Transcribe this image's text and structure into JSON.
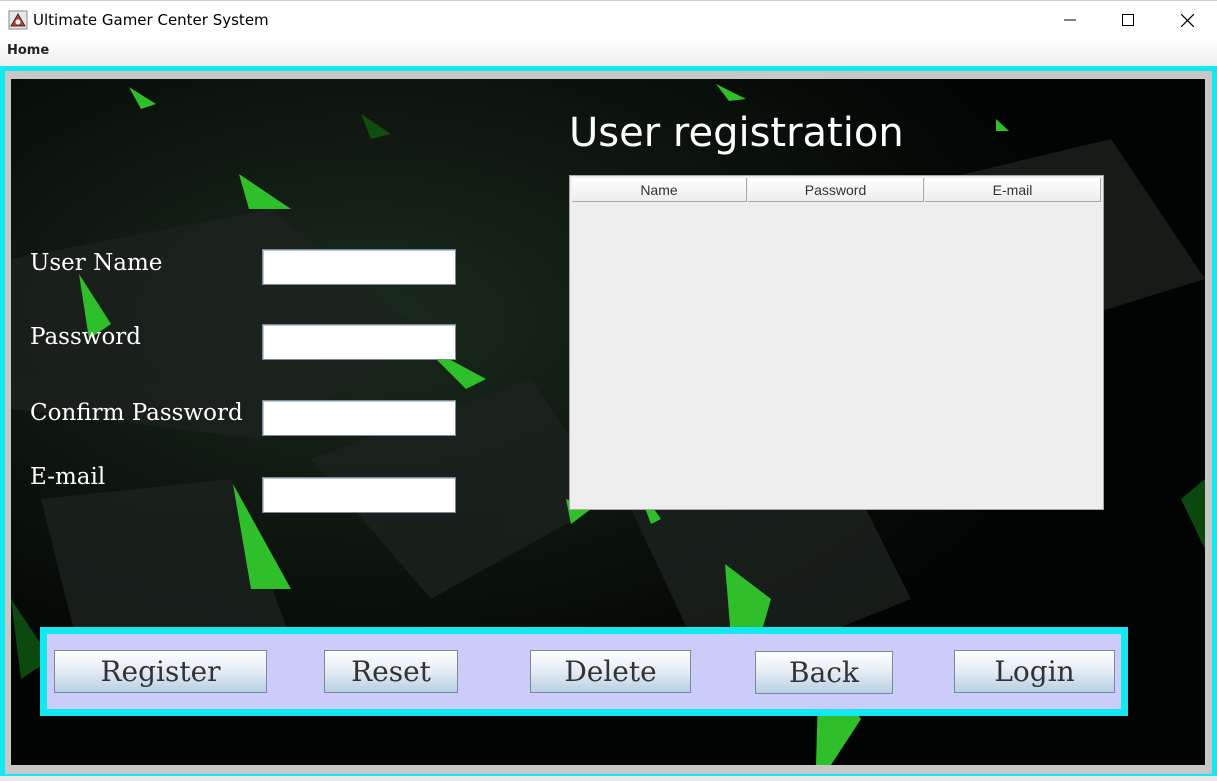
{
  "window": {
    "title": "Ultimate Gamer Center System",
    "controls": [
      "minimize-icon",
      "maximize-icon",
      "close-icon"
    ]
  },
  "menu": {
    "items": [
      {
        "label": "Home"
      }
    ]
  },
  "page": {
    "heading": "User registration"
  },
  "form": {
    "username": {
      "label": "User Name",
      "value": "",
      "placeholder": ""
    },
    "password": {
      "label": "Password",
      "value": "",
      "placeholder": ""
    },
    "confirm_password": {
      "label": "Confirm Password",
      "value": "",
      "placeholder": ""
    },
    "email": {
      "label": "E-mail",
      "value": "",
      "placeholder": ""
    }
  },
  "table": {
    "columns": [
      "Name",
      "Password",
      "E-mail"
    ],
    "rows": []
  },
  "buttons": {
    "register": "Register",
    "reset": "Reset",
    "delete": "Delete",
    "back": "Back",
    "login": "Login"
  },
  "colors": {
    "frame_accent": "#11e9f0",
    "button_panel": "#ccccfb",
    "background_green": "#2fbf2a",
    "background_dark": "#020403"
  }
}
